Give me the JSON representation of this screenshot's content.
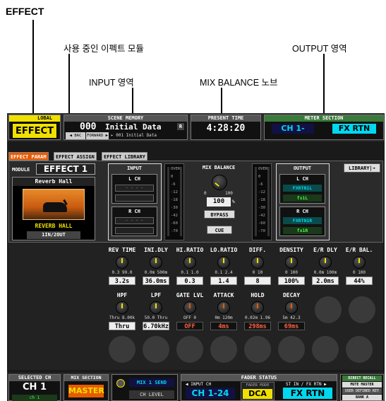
{
  "callouts": {
    "effect": "EFFECT",
    "module_in_use": "사용 중인 이펙트 모듈",
    "output_area": "OUTPUT 영역",
    "input_area": "INPUT 영역",
    "mix_balance_knob": "MIX BALANCE 노브"
  },
  "top_bar": {
    "global_label": "LOBAL",
    "effect_label": "EFFECT",
    "scene_memory_label": "SCENE MEMORY",
    "scene_number": "000",
    "scene_name": "Initial Data",
    "scene_flag": "R",
    "back_label": "◀ BAC",
    "forward_label": "FORWARD ▶",
    "next_scene_label": "NEXT SCENE",
    "next_scene_name": "▸ 001 Initial Data",
    "present_time_label": "PRESENT TIME",
    "present_time": "4:28:20",
    "meter_section_label": "METER SECTION",
    "meter_ch": "CH 1-",
    "meter_fx": "FX RTN"
  },
  "tabs": [
    "EFFECT PARAM",
    "EFFECT ASSIGN",
    "EFFECT LIBRARY"
  ],
  "module": {
    "label": "MODULE",
    "value": "EFFECT 1",
    "preset_name": "Reverb Hall",
    "type_name": "REVERB HALL",
    "io": "1IN/2OUT",
    "library_button": "LIBRARY|➔"
  },
  "input_area": {
    "title": "INPUT",
    "l_ch": "L CH",
    "l_val": "- - - -",
    "r_ch": "R CH",
    "r_val": "- - - -"
  },
  "mix": {
    "title": "MIX BALANCE",
    "scale_min": "0",
    "scale_max": "100",
    "value": "100",
    "unit": "%",
    "bypass": "BYPASS",
    "cue": "CUE"
  },
  "output_area": {
    "title": "OUTPUT",
    "l_ch": "L CH",
    "l_bus": "FXRTN1L",
    "l_sub": "fx1L",
    "r_ch": "R CH",
    "r_bus": "FXRTN1R",
    "r_sub": "fx1R"
  },
  "meter_scale": [
    "OVER",
    "0",
    "-6",
    "-12",
    "-18",
    "-30",
    "-42",
    "-60",
    "-70"
  ],
  "params_row1": [
    {
      "name": "REV TIME",
      "range": "0.3  99.0",
      "value": "3.2s"
    },
    {
      "name": "INI.DLY",
      "range": "0.0m 500m",
      "value": "36.0ms"
    },
    {
      "name": "HI.RATIO",
      "range": "0.1   1.0",
      "value": "0.3"
    },
    {
      "name": "LO.RATIO",
      "range": "0.1   2.4",
      "value": "1.4"
    },
    {
      "name": "DIFF.",
      "range": "0     10",
      "value": "8"
    },
    {
      "name": "DENSITY",
      "range": "0    100",
      "value": "100%"
    },
    {
      "name": "E/R DLY",
      "range": "0.0m 100m",
      "value": "2.0ms"
    },
    {
      "name": "E/R BAL.",
      "range": "0    100",
      "value": "44%"
    }
  ],
  "params_row2": [
    {
      "name": "HPF",
      "range": "Thru 8.00k",
      "value": "Thru"
    },
    {
      "name": "LPF",
      "range": "50.0  Thru",
      "value": "6.70kHz"
    },
    {
      "name": "GATE LVL",
      "range": "OFF     0",
      "value": "OFF"
    },
    {
      "name": "ATTACK",
      "range": "0m   120m",
      "value": "4ms"
    },
    {
      "name": "HOLD",
      "range": "0.02m 1.96",
      "value": "298ms"
    },
    {
      "name": "DECAY",
      "range": "5m   42.3",
      "value": "69ms"
    }
  ],
  "bottom_bar": {
    "selected_ch_label": "SELECTED CH",
    "selected_ch": "CH 1",
    "selected_ch_sub": "ch 1",
    "mix_section_label": "MIX SECTION",
    "master": "MASTER",
    "mix_send": "MIX 1 SEND",
    "ch_level": "CH LEVEL",
    "fader_status_label": "FADER STATUS",
    "input_ch_label": "◀ INPUT CH",
    "input_ch": "CH 1-24",
    "fader_mode_label": "FADER MODE",
    "fader_mode": "DCA",
    "st_in_label": "ST IN / FX RTN ▶",
    "st_in": "FX RTN",
    "direct_recall": "DIRECT RECALL",
    "mute_master": "MUTE MASTER",
    "user_defined": "USER DEFINED KEY",
    "bank": "BANK A"
  },
  "colors": {
    "yellow": "#f0e000",
    "cyan": "#00d8f0",
    "orange": "#e85a00",
    "green_text": "#40ff40",
    "red_text": "#ff6040"
  }
}
